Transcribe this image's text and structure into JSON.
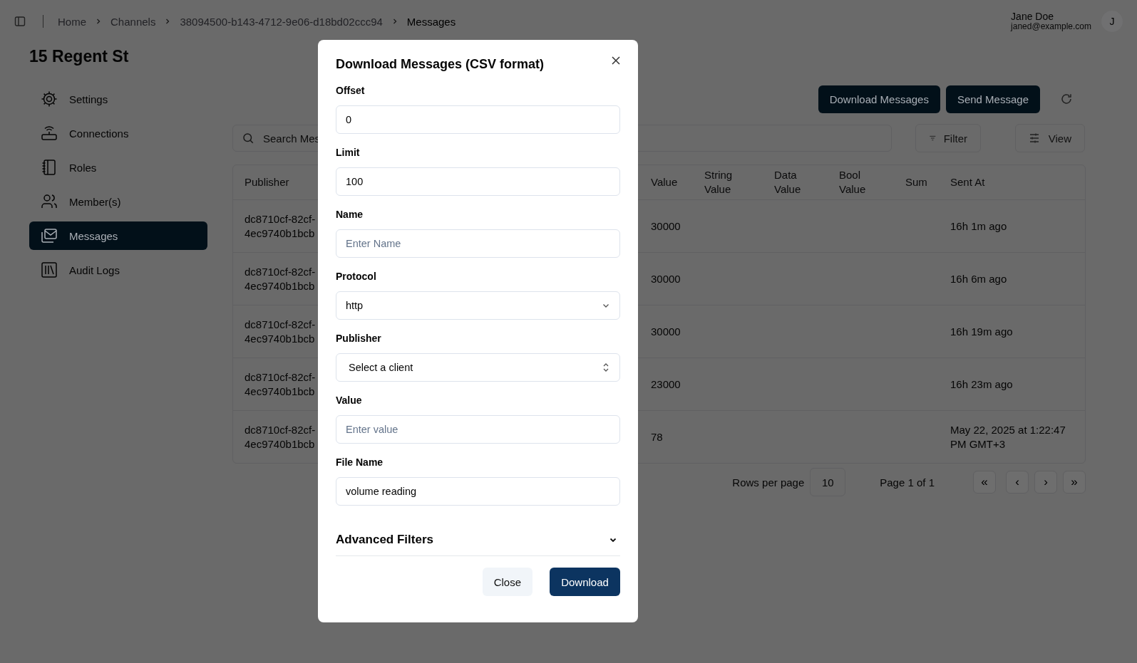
{
  "breadcrumbs": [
    {
      "label": "Home",
      "current": false
    },
    {
      "label": "Channels",
      "current": false
    },
    {
      "label": "38094500-b143-4712-9e06-d18bd02ccc94",
      "current": false
    },
    {
      "label": "Messages",
      "current": true
    }
  ],
  "user": {
    "name": "Jane Doe",
    "email": "janed@example.com",
    "initial": "J"
  },
  "page_title": "15 Regent St",
  "sidebar": {
    "items": [
      {
        "label": "Settings",
        "selected": false
      },
      {
        "label": "Connections",
        "selected": false
      },
      {
        "label": "Roles",
        "selected": false
      },
      {
        "label": "Member(s)",
        "selected": false
      },
      {
        "label": "Messages",
        "selected": true
      },
      {
        "label": "Audit Logs",
        "selected": false
      }
    ]
  },
  "actions": [
    "Download Messages",
    "Send Message"
  ],
  "search": {
    "placeholder": "Search Mes"
  },
  "filter_button": "Filter",
  "view_button": "View",
  "table": {
    "columns": [
      "Publisher",
      "Value",
      "String Value",
      "Data Value",
      "Bool Value",
      "Sum",
      "Sent At"
    ],
    "rows": [
      {
        "publisher": "dc8710cf-82cf-4ec9740b1bcb",
        "value": "30000",
        "sent_at": "16h 1m ago"
      },
      {
        "publisher": "dc8710cf-82cf-4ec9740b1bcb",
        "value": "30000",
        "sent_at": "16h 6m ago"
      },
      {
        "publisher": "dc8710cf-82cf-4ec9740b1bcb",
        "value": "30000",
        "sent_at": "16h 19m ago"
      },
      {
        "publisher": "dc8710cf-82cf-4ec9740b1bcb",
        "value": "23000",
        "sent_at": "16h 23m ago"
      },
      {
        "publisher": "dc8710cf-82cf-4ec9740b1bcb",
        "value": "78",
        "sent_at": "May 22, 2025 at 1:22:47 PM GMT+3"
      }
    ]
  },
  "pagination": {
    "rows_per_page_label": "Rows per page",
    "rows_per_page": "10",
    "page_label": "Page 1 of 1",
    "buttons": [
      "«",
      "‹",
      "›",
      "»"
    ]
  },
  "dialog": {
    "title": "Download Messages (CSV format)",
    "fields": [
      {
        "label": "Offset",
        "kind": "input",
        "value": "0"
      },
      {
        "label": "Limit",
        "kind": "input",
        "value": "100"
      },
      {
        "label": "Name",
        "kind": "input",
        "placeholder": "Enter Name"
      },
      {
        "label": "Protocol",
        "kind": "select",
        "value": "http"
      },
      {
        "label": "Publisher",
        "kind": "combobox",
        "value": "Select a client"
      },
      {
        "label": "Value",
        "kind": "input",
        "placeholder": "Enter value"
      },
      {
        "label": "File Name",
        "kind": "input",
        "value": "volume reading"
      }
    ],
    "advanced": {
      "label": "Advanced Filters",
      "expanded": false
    },
    "buttons": [
      {
        "label": "Close",
        "kind": "secondary"
      },
      {
        "label": "Download",
        "kind": "primary"
      }
    ]
  }
}
